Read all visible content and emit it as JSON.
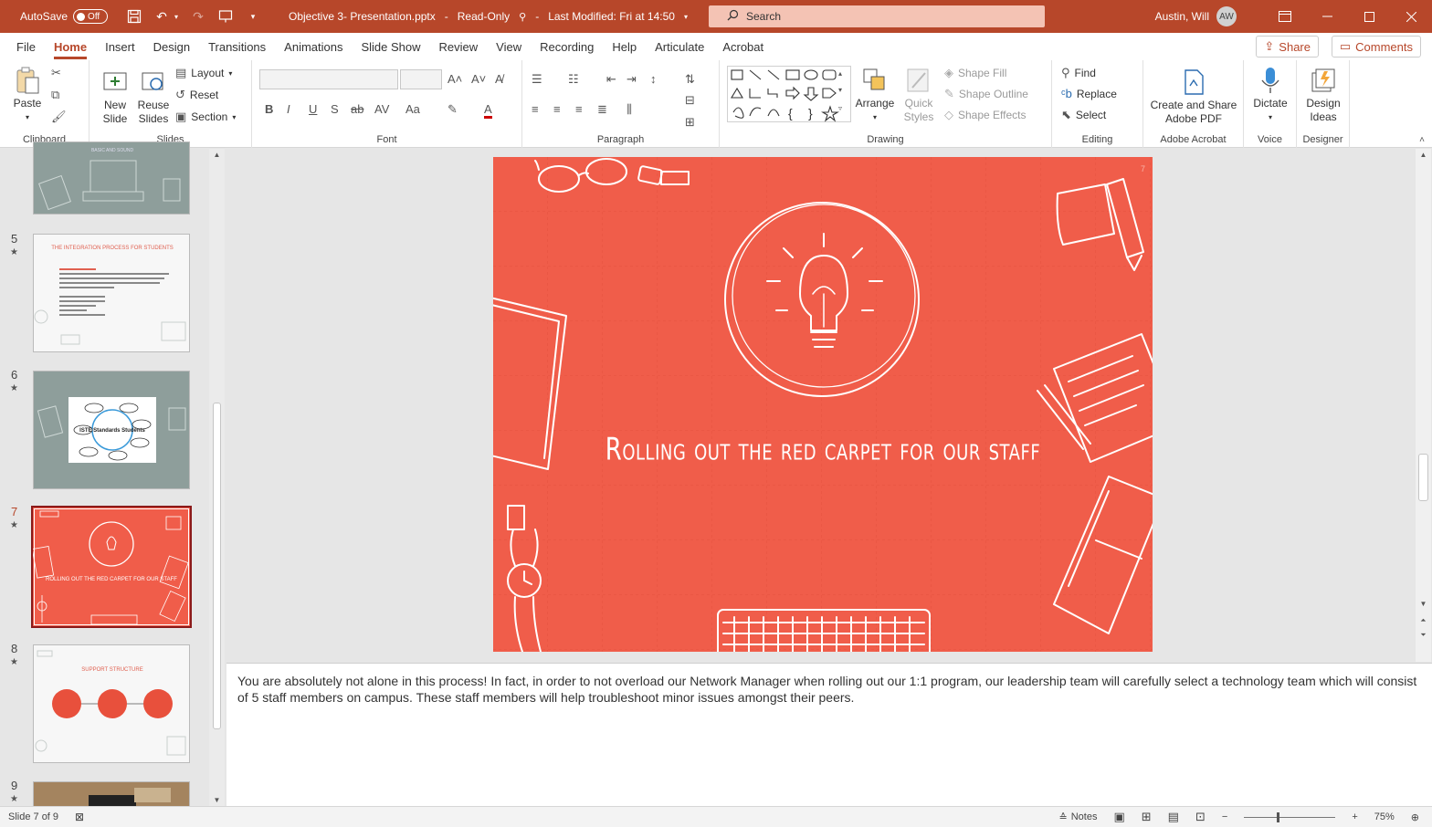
{
  "titlebar": {
    "autosave_label": "AutoSave",
    "autosave_state": "Off",
    "filename": "Objective 3- Presentation.pptx",
    "separator": "-",
    "readonly": "Read-Only",
    "last_modified": "Last Modified: Fri at 14:50",
    "search_placeholder": "Search",
    "user_name": "Austin, Will",
    "user_initials": "AW",
    "accent_color": "#b7472a"
  },
  "tabs": [
    {
      "label": "File"
    },
    {
      "label": "Home"
    },
    {
      "label": "Insert"
    },
    {
      "label": "Design"
    },
    {
      "label": "Transitions"
    },
    {
      "label": "Animations"
    },
    {
      "label": "Slide Show"
    },
    {
      "label": "Review"
    },
    {
      "label": "View"
    },
    {
      "label": "Recording"
    },
    {
      "label": "Help"
    },
    {
      "label": "Articulate"
    },
    {
      "label": "Acrobat"
    }
  ],
  "active_tab": "Home",
  "header_buttons": {
    "share": "Share",
    "comments": "Comments"
  },
  "ribbon": {
    "clipboard": {
      "label": "Clipboard",
      "paste": "Paste"
    },
    "slides": {
      "label": "Slides",
      "new_slide_1": "New",
      "new_slide_2": "Slide",
      "reuse_1": "Reuse",
      "reuse_2": "Slides",
      "layout": "Layout",
      "reset": "Reset",
      "section": "Section"
    },
    "font": {
      "label": "Font"
    },
    "paragraph": {
      "label": "Paragraph"
    },
    "drawing": {
      "label": "Drawing",
      "arrange": "Arrange",
      "quick_styles_1": "Quick",
      "quick_styles_2": "Styles",
      "shape_fill": "Shape Fill",
      "shape_outline": "Shape Outline",
      "shape_effects": "Shape Effects"
    },
    "editing": {
      "label": "Editing",
      "find": "Find",
      "replace": "Replace",
      "select": "Select"
    },
    "acrobat": {
      "label": "Adobe Acrobat",
      "create_1": "Create and Share",
      "create_2": "Adobe PDF"
    },
    "voice": {
      "label": "Voice",
      "dictate": "Dictate"
    },
    "designer": {
      "label": "Designer",
      "ideas_1": "Design",
      "ideas_2": "Ideas"
    }
  },
  "thumbnails": [
    {
      "number": "",
      "type": "gray",
      "title": "BASIC AND SOUND"
    },
    {
      "number": "5",
      "type": "white",
      "title": "THE INTEGRATION PROCESS FOR STUDENTS"
    },
    {
      "number": "6",
      "type": "gray-iste",
      "title": "ISTE Standards Students"
    },
    {
      "number": "7",
      "type": "red",
      "title": "ROLLING OUT THE RED CARPET FOR OUR STAFF",
      "selected": true
    },
    {
      "number": "8",
      "type": "white-circles",
      "title": "SUPPORT STRUCTURE"
    },
    {
      "number": "9",
      "type": "photo",
      "title": ""
    }
  ],
  "slide": {
    "title": "Rolling out the red carpet for our staff",
    "number": "7",
    "background": "#f05d4a"
  },
  "notes": {
    "text": "You are absolutely not alone in this process! In fact, in order to not overload our Network Manager when rolling out our 1:1 program, our leadership team will carefully select a technology team which will consist of 5 staff members on campus. These staff members will help troubleshoot minor issues amongst their peers."
  },
  "status": {
    "slide_counter": "Slide 7 of 9",
    "notes_label": "Notes",
    "zoom": "75%"
  }
}
